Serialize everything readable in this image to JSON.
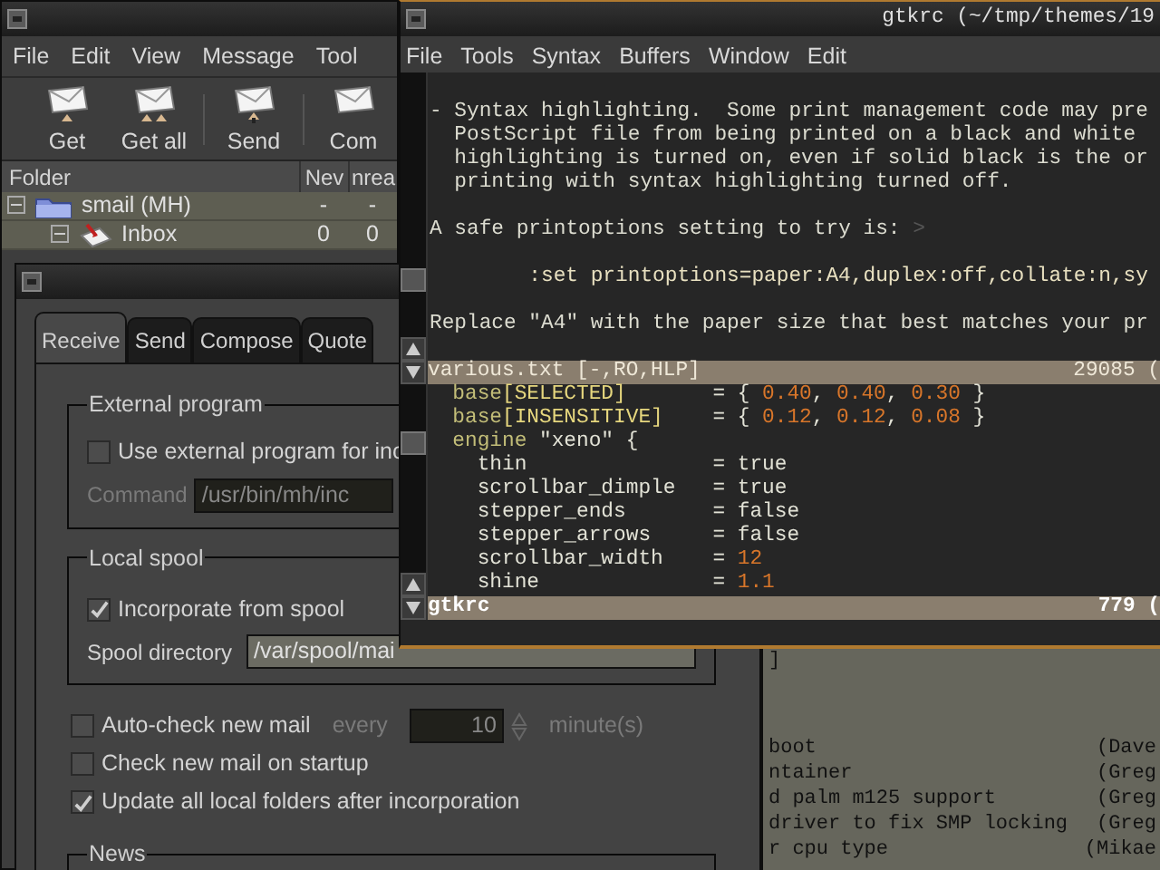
{
  "mail_window": {
    "menu": [
      "File",
      "Edit",
      "View",
      "Message",
      "Tool"
    ],
    "toolbar": [
      {
        "label": "Get",
        "kind": "get"
      },
      {
        "label": "Get all",
        "kind": "getall"
      },
      {
        "label": "Send",
        "kind": "send"
      },
      {
        "label": "Com",
        "kind": "compose"
      }
    ],
    "folder_columns": [
      "Folder",
      "Nev",
      "nrea"
    ],
    "folders": [
      {
        "name": "smail (MH)",
        "kind": "mailbox",
        "new": "-",
        "unread": "-",
        "expanded": true,
        "children": [
          {
            "name": "Inbox",
            "kind": "inbox",
            "new": "0",
            "unread": "0",
            "expanded": true
          }
        ]
      }
    ]
  },
  "prefs_dialog": {
    "tabs": [
      {
        "label": "Receive",
        "selected": true
      },
      {
        "label": "Send",
        "selected": false
      },
      {
        "label": "Compose",
        "selected": false
      },
      {
        "label": "Quote",
        "selected": false
      }
    ],
    "external_program": {
      "title": "External program",
      "use_external": {
        "label": "Use external program for inc",
        "checked": false
      },
      "command": {
        "label": "Command",
        "value": "/usr/bin/mh/inc"
      }
    },
    "local_spool": {
      "title": "Local spool",
      "incorporate": {
        "label": "Incorporate from spool",
        "checked": true
      },
      "spool_directory": {
        "label": "Spool directory",
        "value": "/var/spool/mai"
      }
    },
    "options": [
      {
        "kind": "interval",
        "label": "Auto-check new mail",
        "checked": false,
        "every": "every",
        "value": "10",
        "unit": "minute(s)"
      },
      {
        "kind": "check",
        "label": "Check new mail on startup",
        "checked": false
      },
      {
        "kind": "check",
        "label": "Update all local folders after incorporation",
        "checked": true
      }
    ],
    "news_title": "News"
  },
  "editor": {
    "title": "gtkrc (~/tmp/themes/19",
    "menu": [
      "File",
      "Tools",
      "Syntax",
      "Buffers",
      "Window",
      "Edit"
    ],
    "help": [
      {
        "kind": "para",
        "lines": [
          "- Syntax highlighting.  Some print management code may pre",
          "PostScript file from being printed on a black and white ",
          "highlighting is turned on, even if solid black is the or",
          "printing with syntax highlighting turned off."
        ]
      },
      {
        "kind": "prompt",
        "text": "A safe printoptions setting to try is:",
        "marker": ">"
      },
      {
        "kind": "command",
        "text": ":set printoptions=paper:A4,duplex:off,collate:n,sy"
      },
      {
        "kind": "para",
        "lines": [
          "Replace \"A4\" with the paper size that best matches your pr"
        ]
      }
    ],
    "help_status": {
      "name": "various.txt [-,RO,HLP]",
      "position": "29085 (",
      "active": false
    },
    "code": [
      {
        "key": [
          {
            "text": "base",
            "kind": "type"
          },
          {
            "text": "[SELECTED]",
            "kind": "state"
          }
        ],
        "op": "=",
        "value": [
          {
            "text": "{ ",
            "kind": "plain"
          },
          {
            "text": "0.40",
            "kind": "number"
          },
          {
            "text": ", ",
            "kind": "plain"
          },
          {
            "text": "0.40",
            "kind": "number"
          },
          {
            "text": ", ",
            "kind": "plain"
          },
          {
            "text": "0.30",
            "kind": "number"
          },
          {
            "text": " }",
            "kind": "plain"
          }
        ]
      },
      {
        "key": [
          {
            "text": "base",
            "kind": "type"
          },
          {
            "text": "[INSENSITIVE]",
            "kind": "state"
          }
        ],
        "op": "=",
        "value": [
          {
            "text": "{ ",
            "kind": "plain"
          },
          {
            "text": "0.12",
            "kind": "number"
          },
          {
            "text": ", ",
            "kind": "plain"
          },
          {
            "text": "0.12",
            "kind": "number"
          },
          {
            "text": ", ",
            "kind": "plain"
          },
          {
            "text": "0.08",
            "kind": "number"
          },
          {
            "text": " }",
            "kind": "plain"
          }
        ]
      },
      {
        "segments": [
          {
            "text": "engine",
            "kind": "type"
          },
          {
            "text": " \"xeno\" {",
            "kind": "plain"
          }
        ],
        "children": [
          {
            "key": [
              {
                "text": "thin",
                "kind": "plain"
              }
            ],
            "op": "=",
            "value": [
              {
                "text": "true",
                "kind": "plain"
              }
            ]
          },
          {
            "key": [
              {
                "text": "scrollbar_dimple",
                "kind": "plain"
              }
            ],
            "op": "=",
            "value": [
              {
                "text": "true",
                "kind": "plain"
              }
            ]
          },
          {
            "key": [
              {
                "text": "stepper_ends",
                "kind": "plain"
              }
            ],
            "op": "=",
            "value": [
              {
                "text": "false",
                "kind": "plain"
              }
            ]
          },
          {
            "key": [
              {
                "text": "stepper_arrows",
                "kind": "plain"
              }
            ],
            "op": "=",
            "value": [
              {
                "text": "false",
                "kind": "plain"
              }
            ]
          },
          {
            "key": [
              {
                "text": "scrollbar_width",
                "kind": "plain"
              }
            ],
            "op": "=",
            "value": [
              {
                "text": "12",
                "kind": "number"
              }
            ]
          },
          {
            "key": [
              {
                "text": "shine",
                "kind": "plain"
              }
            ],
            "op": "=",
            "value": [
              {
                "text": "1.1",
                "kind": "number"
              }
            ]
          }
        ]
      }
    ],
    "code_status": {
      "name": "gtkrc",
      "position": "779 (",
      "active": true
    }
  },
  "terminal": {
    "cursor_line": "]",
    "rows": [
      {
        "summary": "boot",
        "author": "(Dave"
      },
      {
        "summary": "ntainer",
        "author": "(Greg"
      },
      {
        "summary": "d palm m125 support",
        "author": "(Greg"
      },
      {
        "summary": "driver to fix SMP locking",
        "author": "(Greg"
      },
      {
        "summary": "r cpu type",
        "author": "(Mikae"
      }
    ]
  }
}
